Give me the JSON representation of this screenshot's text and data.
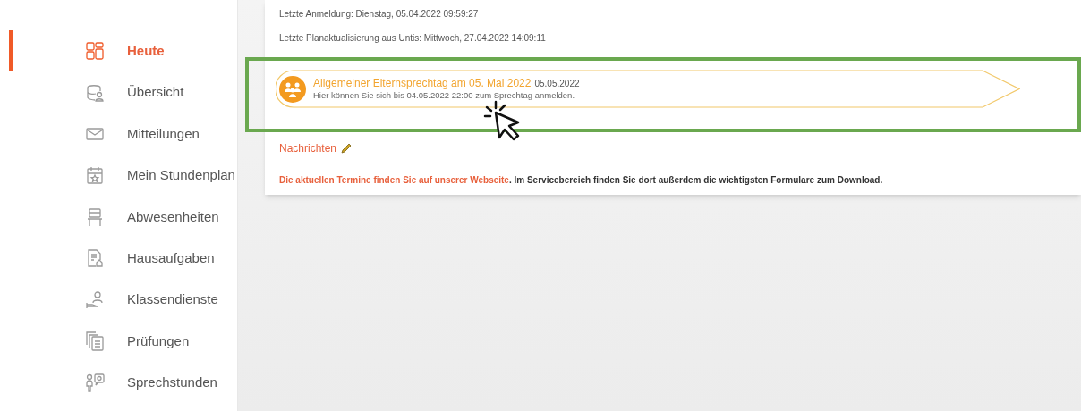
{
  "sidebar": {
    "items": [
      {
        "label": "Heute",
        "selected": true
      },
      {
        "label": "Übersicht",
        "selected": false
      },
      {
        "label": "Mitteilungen",
        "selected": false
      },
      {
        "label": "Mein Stundenplan",
        "selected": false
      },
      {
        "label": "Abwesenheiten",
        "selected": false
      },
      {
        "label": "Hausaufgaben",
        "selected": false
      },
      {
        "label": "Klassendienste",
        "selected": false
      },
      {
        "label": "Prüfungen",
        "selected": false
      },
      {
        "label": "Sprechstunden",
        "selected": false
      }
    ]
  },
  "info": [
    "Letzte Anmeldung: Dienstag, 05.04.2022 09:59:27",
    "Letzte Planaktualisierung aus Untis: Mittwoch, 27.04.2022 14:09:11"
  ],
  "event": {
    "title": "Allgemeiner Elternsprechtag am 05. Mai 2022",
    "date": "05.05.2022",
    "text": "Hier können Sie sich bis 04.05.2022 22:00 zum Sprechtag anmelden."
  },
  "news": {
    "title": "Nachrichten",
    "link": "Die aktuellen Termine finden Sie auf unserer Webseite",
    "text": ". Im Servicebereich finden Sie dort außerdem die wichtigsten Formulare zum Download."
  }
}
